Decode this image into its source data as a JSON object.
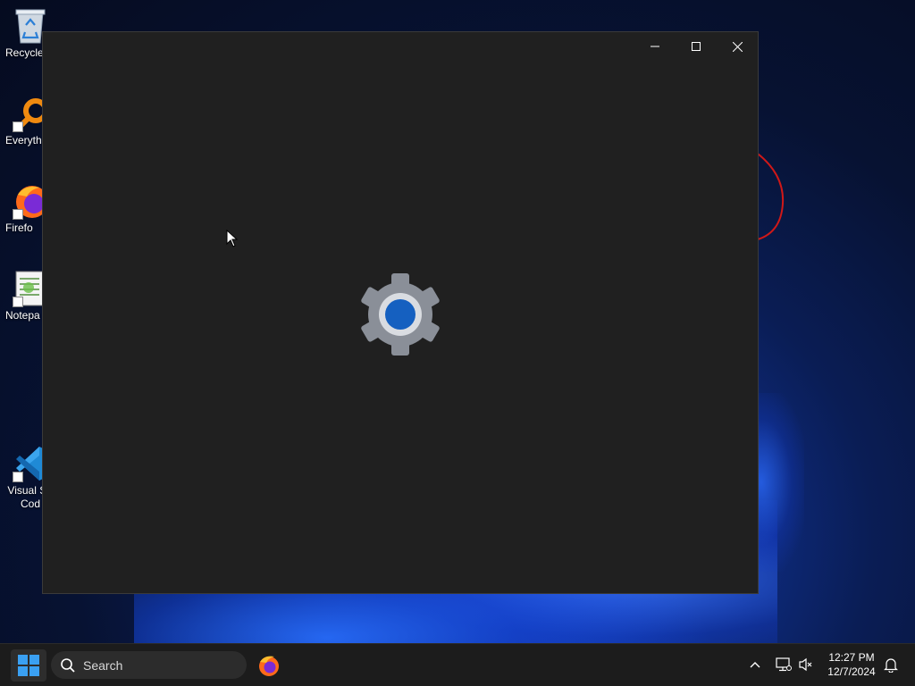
{
  "desktop": {
    "icons": [
      {
        "name": "recycle-bin",
        "label": "Recycle"
      },
      {
        "name": "everything",
        "label": "Everyth"
      },
      {
        "name": "firefox",
        "label": "Firefo"
      },
      {
        "name": "notepad",
        "label": "Notepa"
      },
      {
        "name": "vscode",
        "label_line1": "Visual St",
        "label_line2": "Cod"
      }
    ]
  },
  "window": {
    "minimize_icon": "minimize-icon",
    "maximize_icon": "maximize-icon",
    "close_icon": "close-icon",
    "splash_icon": "settings-gear-icon",
    "colors": {
      "background": "#202020",
      "gear": "#8a8f98",
      "gear_center": "#1560c0"
    }
  },
  "taskbar": {
    "start_icon": "windows-start-icon",
    "search": {
      "placeholder": "Search",
      "icon": "search-icon"
    },
    "pinned_apps": [
      {
        "name": "firefox",
        "icon": "firefox-icon"
      }
    ],
    "tray": {
      "overflow_icon": "chevron-up-icon",
      "network_icon": "network-icon",
      "volume_icon": "volume-muted-icon",
      "notification_icon": "bell-icon"
    },
    "clock": {
      "time": "12:27 PM",
      "date": "12/7/2024"
    }
  }
}
